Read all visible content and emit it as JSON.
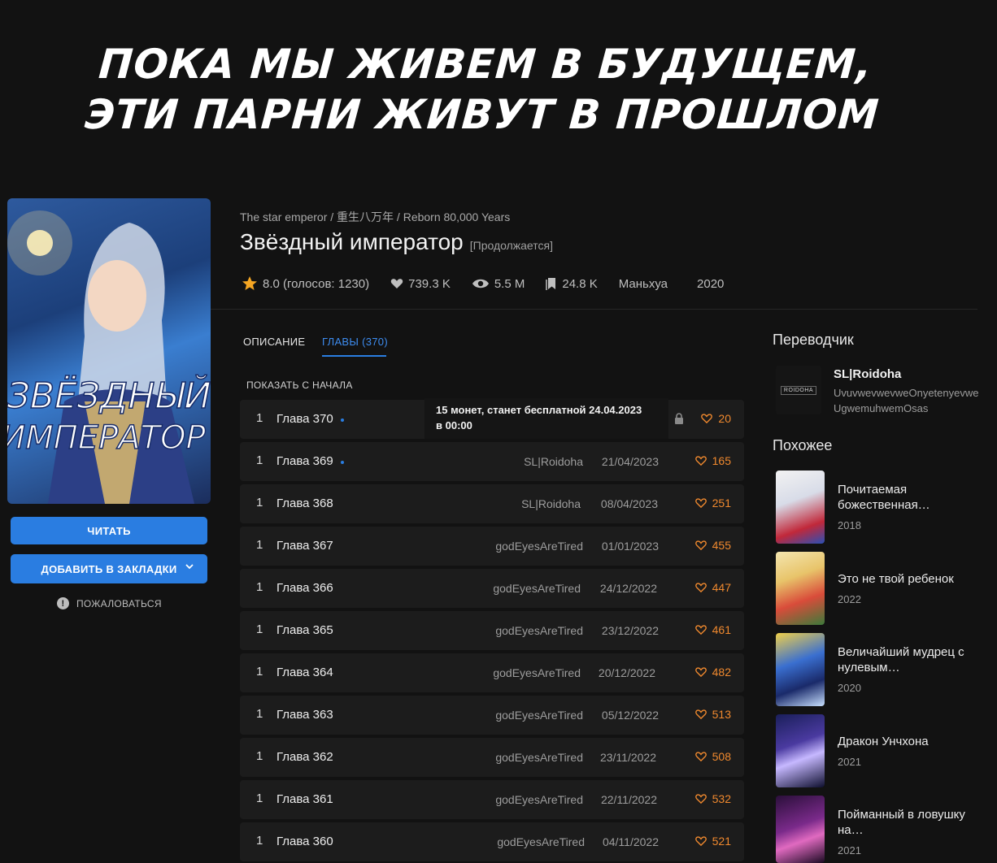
{
  "caption": {
    "line1": "ПОКА МЫ ЖИВЕМ В БУДУЩЕМ,",
    "line2": "ЭТИ ПАРНИ ЖИВУТ В ПРОШЛОМ"
  },
  "cover": {
    "text_line1": "ЗВЁЗДНЫЙ",
    "text_line2": "ИМПЕРАТОР"
  },
  "actions": {
    "read_label": "ЧИТАТЬ",
    "bookmark_label": "ДОБАВИТЬ В ЗАКЛАДКИ",
    "report_label": "ПОЖАЛОВАТЬСЯ"
  },
  "manga": {
    "alt_names": "The star emperor / 重生八万年 / Reborn 80,000 Years",
    "title": "Звёздный император",
    "status": "[Продолжается]",
    "rating": "8.0 (голосов: 1230)",
    "likes": "739.3 K",
    "views": "5.5 M",
    "bookmarks": "24.8 K",
    "type": "Маньхуа",
    "year": "2020"
  },
  "tabs": {
    "description": "ОПИСАНИЕ",
    "chapters": "ГЛАВЫ (370)"
  },
  "list": {
    "from_start": "ПОКАЗАТЬ С НАЧАЛА"
  },
  "chapters": [
    {
      "vol": "1",
      "name": "Глава 370",
      "paid_line1": "15 монет, станет бесплатной 24.04.2023",
      "paid_line2": "в 00:00",
      "likes": "20"
    },
    {
      "vol": "1",
      "name": "Глава 369",
      "user": "SL|Roidoha",
      "date": "21/04/2023",
      "likes": "165"
    },
    {
      "vol": "1",
      "name": "Глава 368",
      "user": "SL|Roidoha",
      "date": "08/04/2023",
      "likes": "251"
    },
    {
      "vol": "1",
      "name": "Глава 367",
      "user": "godEyesAreTired",
      "date": "01/01/2023",
      "likes": "455"
    },
    {
      "vol": "1",
      "name": "Глава 366",
      "user": "godEyesAreTired",
      "date": "24/12/2022",
      "likes": "447"
    },
    {
      "vol": "1",
      "name": "Глава 365",
      "user": "godEyesAreTired",
      "date": "23/12/2022",
      "likes": "461"
    },
    {
      "vol": "1",
      "name": "Глава 364",
      "user": "godEyesAreTired",
      "date": "20/12/2022",
      "likes": "482"
    },
    {
      "vol": "1",
      "name": "Глава 363",
      "user": "godEyesAreTired",
      "date": "05/12/2022",
      "likes": "513"
    },
    {
      "vol": "1",
      "name": "Глава 362",
      "user": "godEyesAreTired",
      "date": "23/11/2022",
      "likes": "508"
    },
    {
      "vol": "1",
      "name": "Глава 361",
      "user": "godEyesAreTired",
      "date": "22/11/2022",
      "likes": "532"
    },
    {
      "vol": "1",
      "name": "Глава 360",
      "user": "godEyesAreTired",
      "date": "04/11/2022",
      "likes": "521"
    }
  ],
  "sidebar": {
    "translator_heading": "Переводчик",
    "translator_logo_text": "ROIDOHA",
    "translator_name": "SL|Roidoha",
    "translator_desc": "UvuvwevwevweOnyetenyevweUgwemuhwemOsas",
    "similar_heading": "Похожее",
    "similar": [
      {
        "title": "Почитаемая божественная…",
        "year": "2018"
      },
      {
        "title": "Это не твой ребенок",
        "year": "2022"
      },
      {
        "title": "Величайший мудрец с нулевым…",
        "year": "2020"
      },
      {
        "title": "Дракон Унчхона",
        "year": "2021"
      },
      {
        "title": "Пойманный в ловушку на…",
        "year": "2021"
      }
    ]
  },
  "colors": {
    "accent": "#2a7de1",
    "like": "#f0892e",
    "background": "#121212",
    "row": "#1c1c1c"
  }
}
